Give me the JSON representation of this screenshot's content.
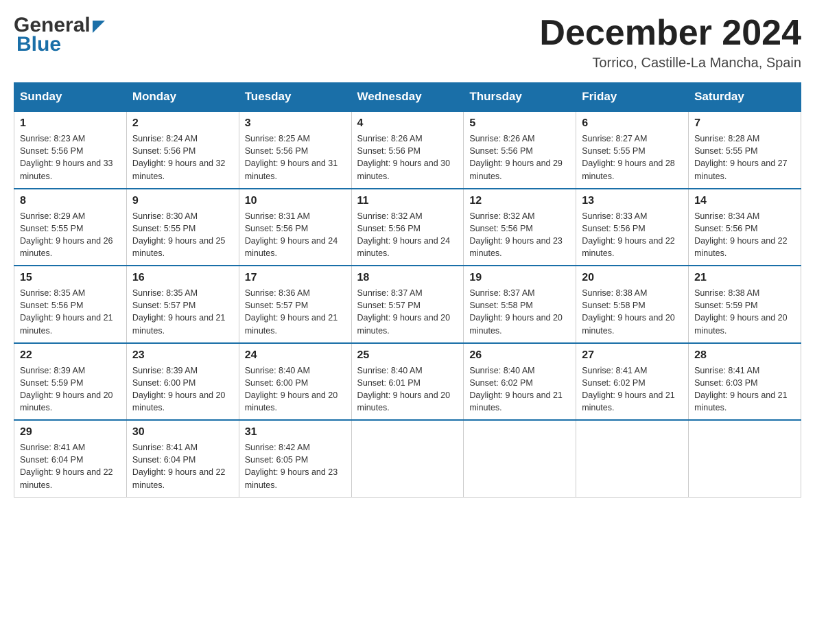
{
  "header": {
    "logo_general": "General",
    "logo_blue": "Blue",
    "month_title": "December 2024",
    "location": "Torrico, Castille-La Mancha, Spain"
  },
  "calendar": {
    "days_of_week": [
      "Sunday",
      "Monday",
      "Tuesday",
      "Wednesday",
      "Thursday",
      "Friday",
      "Saturday"
    ],
    "weeks": [
      [
        {
          "day": "1",
          "sunrise": "8:23 AM",
          "sunset": "5:56 PM",
          "daylight": "9 hours and 33 minutes."
        },
        {
          "day": "2",
          "sunrise": "8:24 AM",
          "sunset": "5:56 PM",
          "daylight": "9 hours and 32 minutes."
        },
        {
          "day": "3",
          "sunrise": "8:25 AM",
          "sunset": "5:56 PM",
          "daylight": "9 hours and 31 minutes."
        },
        {
          "day": "4",
          "sunrise": "8:26 AM",
          "sunset": "5:56 PM",
          "daylight": "9 hours and 30 minutes."
        },
        {
          "day": "5",
          "sunrise": "8:26 AM",
          "sunset": "5:56 PM",
          "daylight": "9 hours and 29 minutes."
        },
        {
          "day": "6",
          "sunrise": "8:27 AM",
          "sunset": "5:55 PM",
          "daylight": "9 hours and 28 minutes."
        },
        {
          "day": "7",
          "sunrise": "8:28 AM",
          "sunset": "5:55 PM",
          "daylight": "9 hours and 27 minutes."
        }
      ],
      [
        {
          "day": "8",
          "sunrise": "8:29 AM",
          "sunset": "5:55 PM",
          "daylight": "9 hours and 26 minutes."
        },
        {
          "day": "9",
          "sunrise": "8:30 AM",
          "sunset": "5:55 PM",
          "daylight": "9 hours and 25 minutes."
        },
        {
          "day": "10",
          "sunrise": "8:31 AM",
          "sunset": "5:56 PM",
          "daylight": "9 hours and 24 minutes."
        },
        {
          "day": "11",
          "sunrise": "8:32 AM",
          "sunset": "5:56 PM",
          "daylight": "9 hours and 24 minutes."
        },
        {
          "day": "12",
          "sunrise": "8:32 AM",
          "sunset": "5:56 PM",
          "daylight": "9 hours and 23 minutes."
        },
        {
          "day": "13",
          "sunrise": "8:33 AM",
          "sunset": "5:56 PM",
          "daylight": "9 hours and 22 minutes."
        },
        {
          "day": "14",
          "sunrise": "8:34 AM",
          "sunset": "5:56 PM",
          "daylight": "9 hours and 22 minutes."
        }
      ],
      [
        {
          "day": "15",
          "sunrise": "8:35 AM",
          "sunset": "5:56 PM",
          "daylight": "9 hours and 21 minutes."
        },
        {
          "day": "16",
          "sunrise": "8:35 AM",
          "sunset": "5:57 PM",
          "daylight": "9 hours and 21 minutes."
        },
        {
          "day": "17",
          "sunrise": "8:36 AM",
          "sunset": "5:57 PM",
          "daylight": "9 hours and 21 minutes."
        },
        {
          "day": "18",
          "sunrise": "8:37 AM",
          "sunset": "5:57 PM",
          "daylight": "9 hours and 20 minutes."
        },
        {
          "day": "19",
          "sunrise": "8:37 AM",
          "sunset": "5:58 PM",
          "daylight": "9 hours and 20 minutes."
        },
        {
          "day": "20",
          "sunrise": "8:38 AM",
          "sunset": "5:58 PM",
          "daylight": "9 hours and 20 minutes."
        },
        {
          "day": "21",
          "sunrise": "8:38 AM",
          "sunset": "5:59 PM",
          "daylight": "9 hours and 20 minutes."
        }
      ],
      [
        {
          "day": "22",
          "sunrise": "8:39 AM",
          "sunset": "5:59 PM",
          "daylight": "9 hours and 20 minutes."
        },
        {
          "day": "23",
          "sunrise": "8:39 AM",
          "sunset": "6:00 PM",
          "daylight": "9 hours and 20 minutes."
        },
        {
          "day": "24",
          "sunrise": "8:40 AM",
          "sunset": "6:00 PM",
          "daylight": "9 hours and 20 minutes."
        },
        {
          "day": "25",
          "sunrise": "8:40 AM",
          "sunset": "6:01 PM",
          "daylight": "9 hours and 20 minutes."
        },
        {
          "day": "26",
          "sunrise": "8:40 AM",
          "sunset": "6:02 PM",
          "daylight": "9 hours and 21 minutes."
        },
        {
          "day": "27",
          "sunrise": "8:41 AM",
          "sunset": "6:02 PM",
          "daylight": "9 hours and 21 minutes."
        },
        {
          "day": "28",
          "sunrise": "8:41 AM",
          "sunset": "6:03 PM",
          "daylight": "9 hours and 21 minutes."
        }
      ],
      [
        {
          "day": "29",
          "sunrise": "8:41 AM",
          "sunset": "6:04 PM",
          "daylight": "9 hours and 22 minutes."
        },
        {
          "day": "30",
          "sunrise": "8:41 AM",
          "sunset": "6:04 PM",
          "daylight": "9 hours and 22 minutes."
        },
        {
          "day": "31",
          "sunrise": "8:42 AM",
          "sunset": "6:05 PM",
          "daylight": "9 hours and 23 minutes."
        },
        null,
        null,
        null,
        null
      ]
    ]
  }
}
